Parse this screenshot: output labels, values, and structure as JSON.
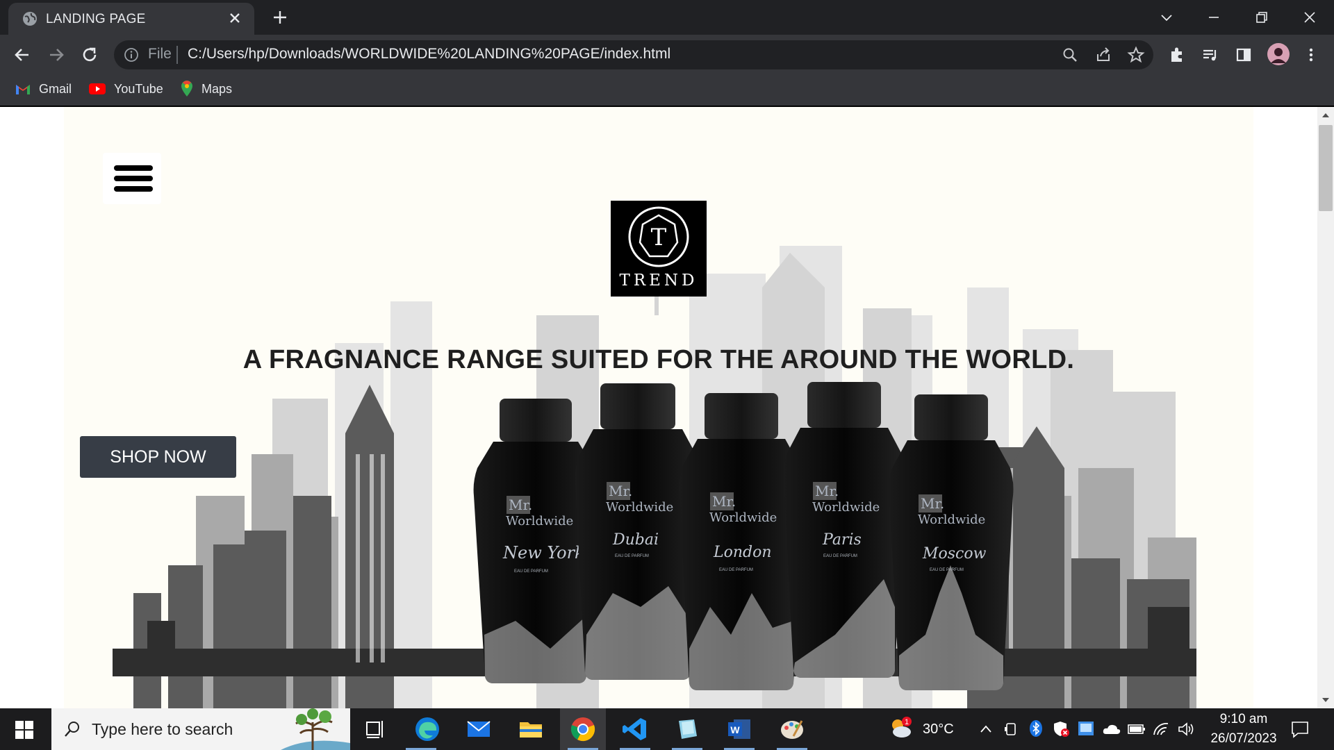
{
  "browser": {
    "tab_title": "LANDING PAGE",
    "omnibox_prefix": "File",
    "url": "C:/Users/hp/Downloads/WORLDWIDE%20LANDING%20PAGE/index.html",
    "bookmarks": [
      {
        "label": "Gmail",
        "icon": "gmail-icon"
      },
      {
        "label": "YouTube",
        "icon": "youtube-icon"
      },
      {
        "label": "Maps",
        "icon": "maps-icon"
      }
    ]
  },
  "page": {
    "logo_text": "TREND",
    "logo_letter": "T",
    "headline": "A FRAGNANCE RANGE SUITED FOR THE AROUND THE WORLD.",
    "shop_button": "SHOP NOW",
    "bottles": [
      {
        "brand_line1": "Mr.",
        "brand_line2": "Worldwide",
        "city": "New York",
        "sub": "EAU DE PARFUM"
      },
      {
        "brand_line1": "Mr.",
        "brand_line2": "Worldwide",
        "city": "Dubai",
        "sub": "EAU DE PARFUM"
      },
      {
        "brand_line1": "Mr.",
        "brand_line2": "Worldwide",
        "city": "London",
        "sub": "EAU DE PARFUM"
      },
      {
        "brand_line1": "Mr.",
        "brand_line2": "Worldwide",
        "city": "Paris",
        "sub": "EAU DE PARFUM"
      },
      {
        "brand_line1": "Mr.",
        "brand_line2": "Worldwide",
        "city": "Moscow",
        "sub": "EAU DE PARFUM"
      }
    ],
    "background_color": "#fefdf6",
    "button_color": "#373d46"
  },
  "taskbar": {
    "search_placeholder": "Type here to search",
    "weather_temp": "30°C",
    "weather_badge": "1",
    "time": "9:10 am",
    "date": "26/07/2023",
    "apps": [
      "task-view-icon",
      "edge-icon",
      "mail-icon",
      "file-explorer-icon",
      "chrome-icon",
      "vscode-icon",
      "notes-icon",
      "word-icon",
      "paint-icon"
    ]
  }
}
